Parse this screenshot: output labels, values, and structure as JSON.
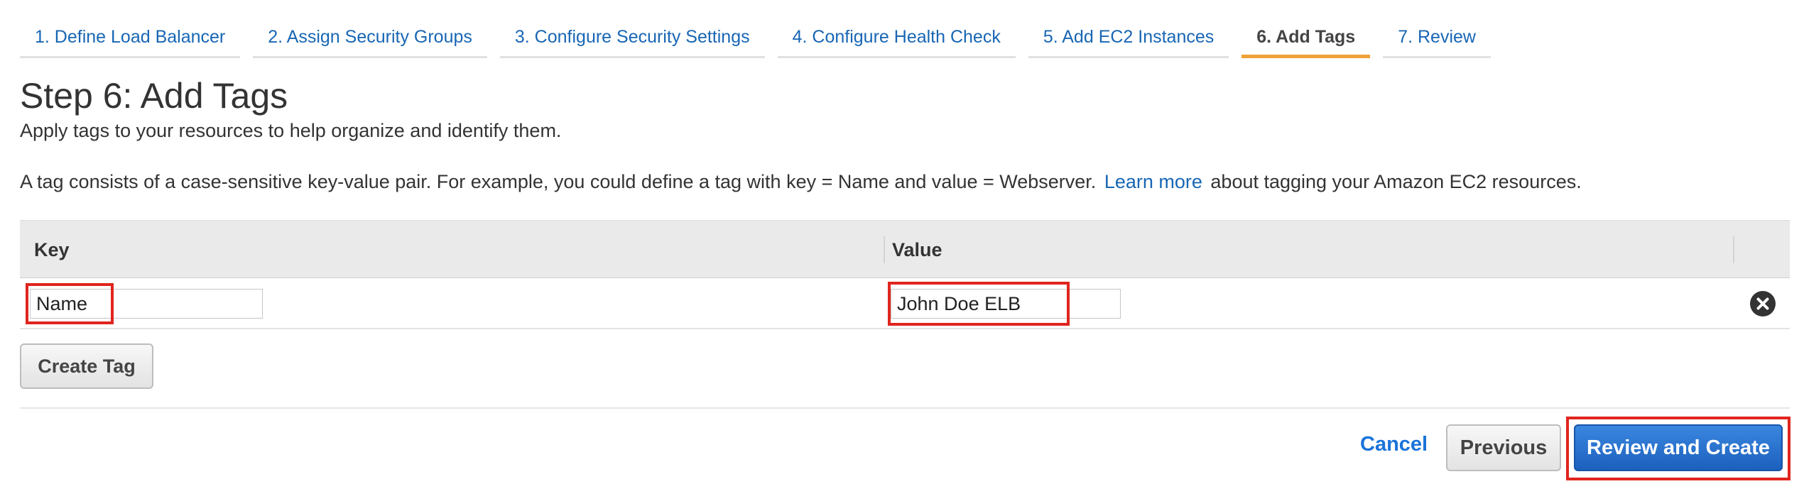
{
  "wizard": {
    "steps": [
      {
        "label": "1. Define Load Balancer",
        "active": false
      },
      {
        "label": "2. Assign Security Groups",
        "active": false
      },
      {
        "label": "3. Configure Security Settings",
        "active": false
      },
      {
        "label": "4. Configure Health Check",
        "active": false
      },
      {
        "label": "5. Add EC2 Instances",
        "active": false
      },
      {
        "label": "6. Add Tags",
        "active": true
      },
      {
        "label": "7. Review",
        "active": false
      }
    ]
  },
  "page": {
    "title": "Step 6: Add Tags",
    "subtitle": "Apply tags to your resources to help organize and identify them.",
    "description_before": "A tag consists of a case-sensitive key-value pair. For example, you could define a tag with key = Name and value = Webserver.",
    "learn_more": "Learn more",
    "description_after": "about tagging your Amazon EC2 resources."
  },
  "table": {
    "columns": [
      "Key",
      "Value"
    ],
    "rows": [
      {
        "key": "Name",
        "value": "John Doe ELB"
      }
    ],
    "remove_icon": "remove-circle-x-icon"
  },
  "actions": {
    "create_tag": "Create Tag",
    "cancel": "Cancel",
    "previous": "Previous",
    "review_and_create": "Review and Create"
  },
  "colors": {
    "link": "#1866b4",
    "active_tab_underline": "#f0a239",
    "highlight_box": "#e0251e",
    "primary_button": "#1c60bd"
  }
}
